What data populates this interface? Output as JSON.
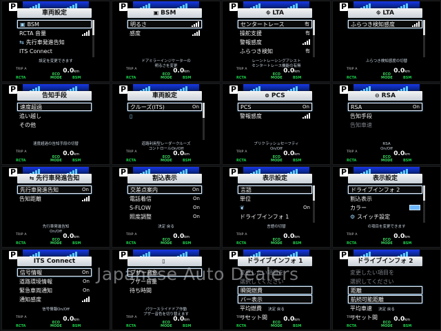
{
  "watermark": "Japanese Auto Dealers",
  "panels": [
    {
      "title": "車両設定",
      "icon": "",
      "rows": [
        {
          "label": "BSM",
          "val": "",
          "sel": true,
          "icon": "bsm-icon"
        },
        {
          "label": "RCTA 音量",
          "val": "",
          "level": true
        },
        {
          "label": "先行車発進告知",
          "val": "",
          "icon": "car-icon"
        },
        {
          "label": "ITS Connect",
          "val": ""
        }
      ],
      "note": "設定を変更できます",
      "scroll": true
    },
    {
      "title": "BSM",
      "icon": "bsm-icon",
      "rows": [
        {
          "label": "明るさ",
          "val": "",
          "sel": true,
          "level": true
        },
        {
          "label": "感度",
          "val": "",
          "level": true
        }
      ],
      "note": "ドアミラーインジケーターの\n明るさを変更"
    },
    {
      "title": "LTA",
      "icon": "lta-icon",
      "rows": [
        {
          "label": "センタートレース",
          "val": "有",
          "sel": true
        },
        {
          "label": "操舵支援",
          "val": "有"
        },
        {
          "label": "警報感度",
          "val": "",
          "level": true
        },
        {
          "label": "ふらつき検知",
          "val": "有"
        }
      ],
      "note": "レーントレーシングアシスト\nセンタートレース機能の有無",
      "scroll": true
    },
    {
      "title": "LTA",
      "icon": "lta-icon",
      "rows": [
        {
          "label": "ふらつき検知感度",
          "val": "",
          "sel": true,
          "level": true
        }
      ],
      "note": "ふらつき検知感度の切替",
      "scroll": true
    },
    {
      "title": "告知手段",
      "icon": "",
      "rows": [
        {
          "label": "速度超過",
          "val": "",
          "sel": true
        },
        {
          "label": "追い越し",
          "val": ""
        },
        {
          "label": "その他",
          "val": ""
        }
      ],
      "note": "速度超過の告知手段の切替"
    },
    {
      "title": "車両設定",
      "icon": "",
      "rows": [
        {
          "label": "クルーズ(ITS)",
          "val": "On",
          "sel": true
        },
        {
          "label": "",
          "val": "",
          "icon": "door-icon"
        }
      ],
      "note": "道路利用型レーダークルーズ\nコントロールOn/Off",
      "scroll": true
    },
    {
      "title": "PCS",
      "icon": "pcs-icon",
      "rows": [
        {
          "label": "PCS",
          "val": "On",
          "sel": true
        },
        {
          "label": "警報感度",
          "val": "",
          "level": true
        }
      ],
      "note": "プリクラッシュセーフティ\nOn/Off"
    },
    {
      "title": "RSA",
      "icon": "rsa-icon",
      "rows": [
        {
          "label": "RSA",
          "val": "On",
          "sel": true
        },
        {
          "label": "告知手段",
          "val": ""
        },
        {
          "label": "告知車速",
          "val": "",
          "dim": true
        }
      ],
      "note": "RSA\nOn/Off"
    },
    {
      "title": "先行車発進告知",
      "icon": "car-icon",
      "rows": [
        {
          "label": "先行車発進告知",
          "val": "On",
          "sel": true
        },
        {
          "label": "告知距離",
          "val": "",
          "level": true
        }
      ],
      "note": "先行車発進告知\nOn/Off"
    },
    {
      "title": "割込表示",
      "icon": "",
      "rows": [
        {
          "label": "交差点案内",
          "val": "On",
          "sel": true
        },
        {
          "label": "電話着信",
          "val": "On"
        },
        {
          "label": "S-FLOW",
          "val": "On"
        },
        {
          "label": "照度調整",
          "val": "On"
        }
      ],
      "note": "決定  戻る"
    },
    {
      "title": "表示設定",
      "icon": "",
      "rows": [
        {
          "label": "言語",
          "val": "",
          "sel": true
        },
        {
          "label": "単位",
          "val": ""
        },
        {
          "label": "",
          "val": "On",
          "icon": "eco-icon"
        },
        {
          "label": "ドライブインフォ 1",
          "val": ""
        }
      ],
      "note": "言語の切替",
      "scroll": true
    },
    {
      "title": "表示設定",
      "icon": "",
      "rows": [
        {
          "label": "ドライブインフォ 2",
          "val": "",
          "sel": true
        },
        {
          "label": "割込表示",
          "val": ""
        },
        {
          "label": "カラー",
          "val": "",
          "swatch": true
        },
        {
          "label": "スイッチ設定",
          "val": "",
          "icon": "switch-icon"
        }
      ],
      "note": "の項目を変更できます",
      "scroll": true
    },
    {
      "title": "ITS Connect",
      "icon": "",
      "rows": [
        {
          "label": "信号情報",
          "val": "On",
          "sel": true
        },
        {
          "label": "道路環境情報",
          "val": "On"
        },
        {
          "label": "緊急車両通知",
          "val": "On"
        },
        {
          "label": "通知感度",
          "val": "",
          "level": true
        }
      ],
      "note": "信号情報On/Off"
    },
    {
      "title": "",
      "icon": "door-icon",
      "rows": [
        {
          "label": "ブザー音色",
          "val": "",
          "sel": true
        },
        {
          "label": "ブザー音量",
          "val": ""
        },
        {
          "label": "待ち時間",
          "val": ""
        }
      ],
      "note": "パワースライドドア作動\nブザー音色を切り替えます"
    },
    {
      "title": "ドライブインフォ 1",
      "icon": "",
      "rows": [
        {
          "label": "変更したい項目を",
          "val": "",
          "plain": true
        },
        {
          "label": "選択してください",
          "val": "",
          "plain": true
        },
        {
          "label": "瞬間燃費",
          "val": "",
          "sel": true
        },
        {
          "label": "バー表示",
          "val": "",
          "sel": true
        },
        {
          "label": "平均燃費",
          "val": ""
        },
        {
          "label": "リセット間",
          "val": ""
        }
      ],
      "note": "決定  戻る"
    },
    {
      "title": "ドライブインフォ 2",
      "icon": "",
      "rows": [
        {
          "label": "変更したい項目を",
          "val": "",
          "plain": true
        },
        {
          "label": "選択してください",
          "val": "",
          "plain": true
        },
        {
          "label": "距離",
          "val": "",
          "sel": true
        },
        {
          "label": "航続可能距離",
          "val": "",
          "sel": true
        },
        {
          "label": "平均車速",
          "val": ""
        },
        {
          "label": "リセット間",
          "val": ""
        }
      ],
      "note": "決定  戻る"
    }
  ],
  "footer": {
    "trip": "TRIP A",
    "odo": "0.0",
    "unit": "km",
    "rcta": "RCTA",
    "eco": "ECO\nMODE",
    "bsm": "BSM",
    "p": "P"
  },
  "colors": {
    "accent": "#1a3cff",
    "indicator": "#19d24a",
    "swatch": "#6db8ff"
  }
}
